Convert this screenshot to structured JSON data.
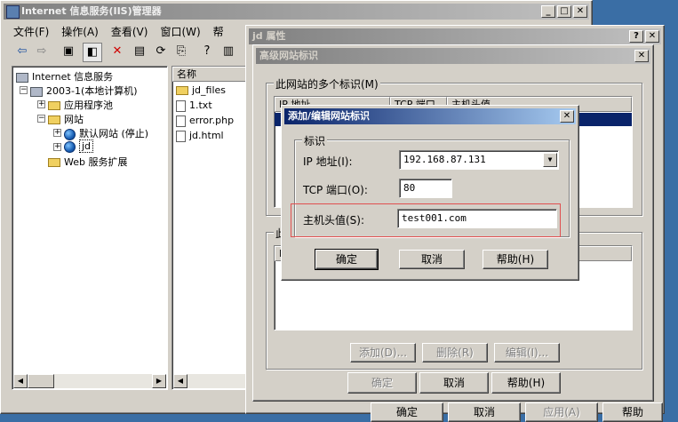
{
  "iis": {
    "title": "Internet 信息服务(IIS)管理器",
    "menu": [
      "文件(F)",
      "操作(A)",
      "查看(V)",
      "窗口(W)",
      "帮"
    ],
    "tree": {
      "root": "Internet 信息服务",
      "server": "2003-1(本地计算机)",
      "apppool": "应用程序池",
      "sites": "网站",
      "default_site": "默认网站 (停止)",
      "jd_site": "jd",
      "webext": "Web 服务扩展"
    },
    "files_header": "名称",
    "files": [
      "jd_files",
      "1.txt",
      "error.php",
      "jd.html"
    ]
  },
  "props": {
    "title": "jd 属性",
    "bottom_buttons": [
      "确定",
      "取消",
      "应用(A)",
      "帮助"
    ]
  },
  "advanced": {
    "title": "高级网站标识",
    "group1_label": "此网站的多个标识(M)",
    "columns": [
      "IP 地址",
      "TCP 端口",
      "主机头值"
    ],
    "group2_label": "此",
    "group2_col": "I",
    "add_button": "添加(D)...",
    "remove_button": "删除(R)",
    "edit_button": "编辑(I)...",
    "ok": "确定",
    "cancel": "取消",
    "help": "帮助(H)"
  },
  "edit_dialog": {
    "title": "添加/编辑网站标识",
    "group_label": "标识",
    "ip_label": "IP 地址(I):",
    "ip_value": "192.168.87.131",
    "port_label": "TCP 端口(O):",
    "port_value": "80",
    "host_label": "主机头值(S):",
    "host_value": "test001.com",
    "ok": "确定",
    "cancel": "取消",
    "help": "帮助(H)"
  },
  "colors": {
    "desktop": "#3a6ea5",
    "title_active": "#0a246a",
    "highlight_box": "#e05050"
  }
}
